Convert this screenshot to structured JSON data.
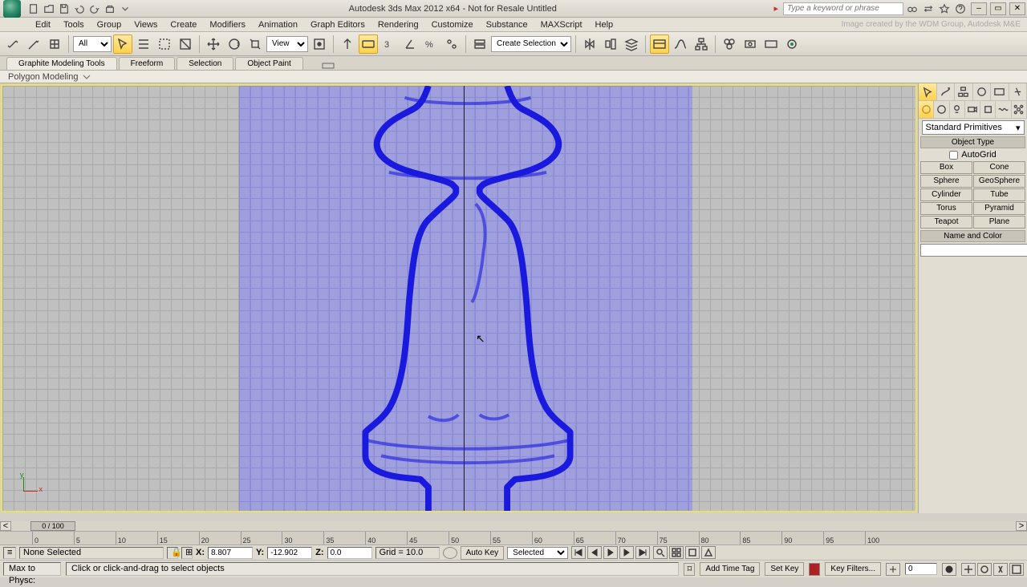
{
  "title": "Autodesk 3ds Max  2012 x64  -  Not for Resale    Untitled",
  "search_placeholder": "Type a keyword or phrase",
  "watermark": "Image created by the WDM Group, Autodesk M&E",
  "menu": [
    "Edit",
    "Tools",
    "Group",
    "Views",
    "Create",
    "Modifiers",
    "Animation",
    "Graph Editors",
    "Rendering",
    "Customize",
    "Substance",
    "MAXScript",
    "Help"
  ],
  "toolbar_filter": "All",
  "ref_coord": "View",
  "selection_set": "Create Selection Se",
  "ribbon_tabs": [
    "Graphite Modeling Tools",
    "Freeform",
    "Selection",
    "Object Paint"
  ],
  "ribbon_panel": "Polygon Modeling",
  "cmd_category": "Standard Primitives",
  "rollouts": {
    "object_type": "Object Type",
    "autogrid": "AutoGrid",
    "name_color": "Name and Color"
  },
  "primitives": [
    "Box",
    "Cone",
    "Sphere",
    "GeoSphere",
    "Cylinder",
    "Tube",
    "Torus",
    "Pyramid",
    "Teapot",
    "Plane"
  ],
  "time": {
    "handle": "0 / 100",
    "ticks": [
      "0",
      "5",
      "10",
      "15",
      "20",
      "25",
      "30",
      "35",
      "40",
      "45",
      "50",
      "55",
      "60",
      "65",
      "70",
      "75",
      "80",
      "85",
      "90",
      "95",
      "100"
    ]
  },
  "status": {
    "selection": "None Selected",
    "x": "8.807",
    "y": "-12.902",
    "z": "0.0",
    "grid": "Grid = 10.0",
    "autokey": "Auto Key",
    "setkey": "Set Key",
    "key_mode": "Selected",
    "key_filters": "Key Filters...",
    "frame": "0"
  },
  "prompt": {
    "script": "Max to Physc:",
    "msg": "Click or click-and-drag to select objects",
    "add_tag": "Add Time Tag"
  }
}
